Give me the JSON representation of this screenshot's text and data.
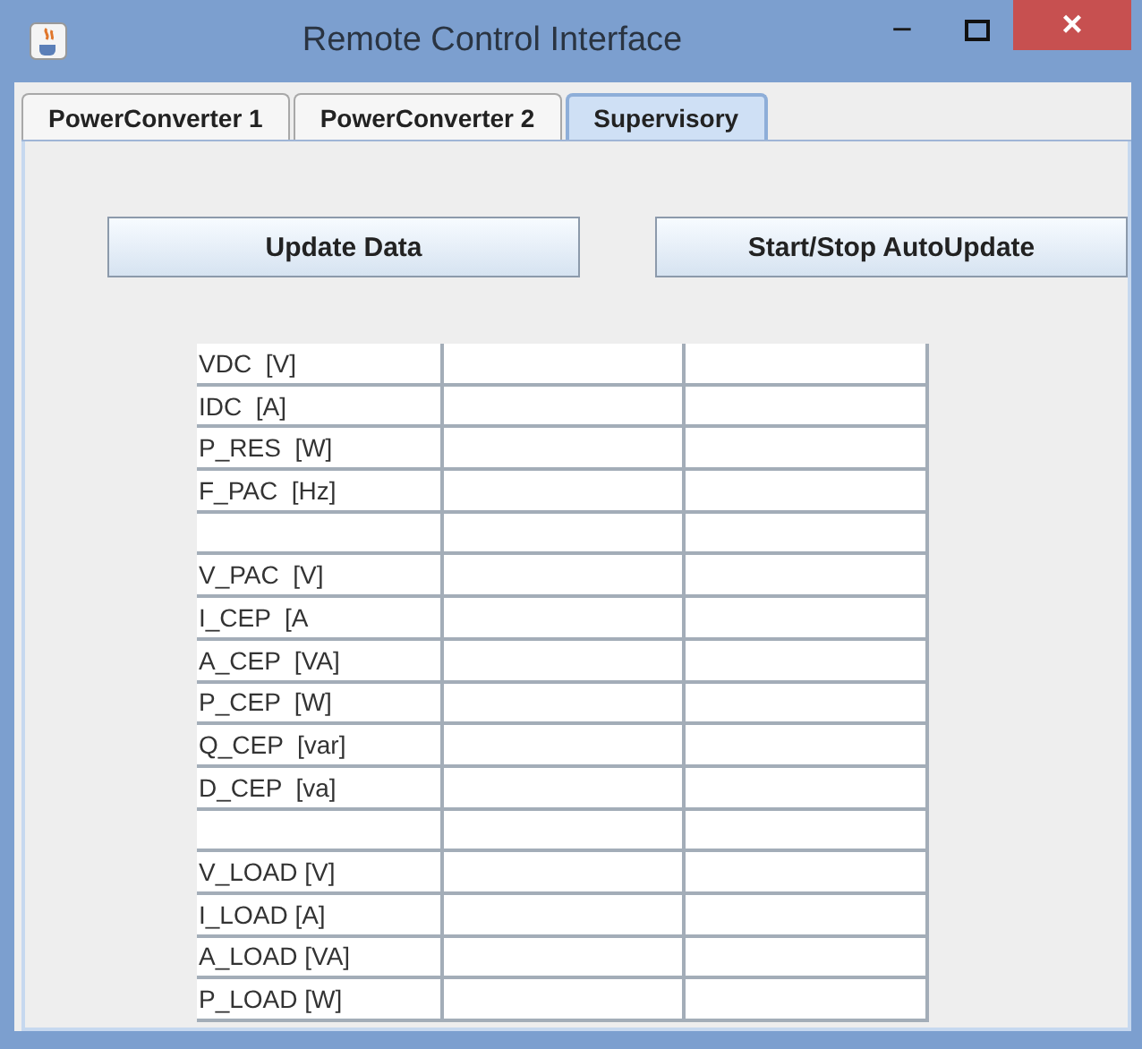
{
  "window": {
    "title": "Remote Control Interface",
    "minimize": "−",
    "close": "×"
  },
  "tabs": [
    {
      "label": "PowerConverter 1",
      "selected": false
    },
    {
      "label": "PowerConverter 2",
      "selected": false
    },
    {
      "label": "Supervisory",
      "selected": true
    }
  ],
  "buttons": [
    "Update Data",
    "Start/Stop AutoUpdate"
  ],
  "table": {
    "rows": [
      {
        "kind": "label",
        "label": "VDC  [V]"
      },
      {
        "kind": "label",
        "label": "IDC  [A]"
      },
      {
        "kind": "label",
        "label": "P_RES  [W]"
      },
      {
        "kind": "label",
        "label": "F_PAC  [Hz]"
      },
      {
        "kind": "blank"
      },
      {
        "kind": "label",
        "label": "V_PAC  [V]"
      },
      {
        "kind": "label",
        "label": "I_CEP  [A"
      },
      {
        "kind": "label",
        "label": "A_CEP  [VA]"
      },
      {
        "kind": "label",
        "label": "P_CEP  [W]"
      },
      {
        "kind": "label",
        "label": "Q_CEP  [var]"
      },
      {
        "kind": "label",
        "label": "D_CEP  [va]"
      },
      {
        "kind": "blank"
      },
      {
        "kind": "label",
        "label": "V_LOAD [V]"
      },
      {
        "kind": "label",
        "label": "I_LOAD [A]"
      },
      {
        "kind": "label",
        "label": "A_LOAD [VA]"
      },
      {
        "kind": "label",
        "label": "P_LOAD [W]"
      }
    ]
  }
}
